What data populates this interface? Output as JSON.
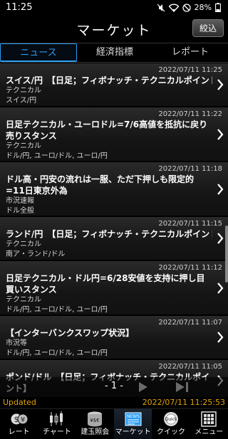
{
  "status_bar": {
    "time": "11:25",
    "battery": "28%"
  },
  "header": {
    "title": "マーケット",
    "filter_label": "絞込"
  },
  "tabs": [
    {
      "label": "ニュース",
      "active": true
    },
    {
      "label": "経済指標",
      "active": false
    },
    {
      "label": "レポート",
      "active": false
    }
  ],
  "news": [
    {
      "date": "2022/07/11 11:25",
      "title": "スイス/円　【日足；フィボナッチ・テクニカルポイント】",
      "meta": [
        "テクニカル",
        "スイス/円"
      ]
    },
    {
      "date": "2022/07/11 11:22",
      "title": "日足テクニカル・ユーロドル=7/6高値を抵抗に戻り売りスタンス",
      "meta": [
        "テクニカル",
        "ドル/円, ユーロ/ドル, ユーロ/円"
      ]
    },
    {
      "date": "2022/07/11 11:18",
      "title": "ドル高・円安の流れは一服、ただ下押しも限定的=11日東京外為",
      "meta": [
        "市況速報",
        "ドル全般"
      ]
    },
    {
      "date": "2022/07/11 11:15",
      "title": "ランド/円　【日足；フィボナッチ・テクニカルポイント】",
      "meta": [
        "テクニカル",
        "南ア・ランド/ドル"
      ]
    },
    {
      "date": "2022/07/11 11:12",
      "title": "日足テクニカル・ドル円=6/28安値を支持に押し目買いスタンス",
      "meta": [
        "テクニカル",
        "ドル/円, ユーロ/ドル, ユーロ/円"
      ]
    },
    {
      "date": "2022/07/11 11:07",
      "title": "【インターバンクスワップ状況】",
      "meta": [
        "市況等",
        "ドル/円, ユーロ/ドル, ユーロ/円"
      ]
    },
    {
      "date": "2022/07/11 11:05",
      "title": "ポンド/ドル　【日足；フィボナッチ・テクニカルポイント】",
      "meta": []
    }
  ],
  "pager": {
    "label": "- 1 -"
  },
  "updated": {
    "label": "Updated",
    "time": "2022/07/11 11:25:53"
  },
  "bottom_nav": [
    {
      "label": "レート",
      "icon": "rate-icon",
      "active": false
    },
    {
      "label": "チャート",
      "icon": "chart-icon",
      "active": false
    },
    {
      "label": "建玉照会",
      "icon": "position-icon",
      "active": false
    },
    {
      "label": "マーケット",
      "icon": "news-icon",
      "active": true
    },
    {
      "label": "クイック",
      "icon": "quick-icon",
      "active": false
    },
    {
      "label": "メニュー",
      "icon": "menu-icon",
      "active": false
    }
  ],
  "colors": {
    "accent": "#2a9df4",
    "updated": "#e0a400"
  }
}
